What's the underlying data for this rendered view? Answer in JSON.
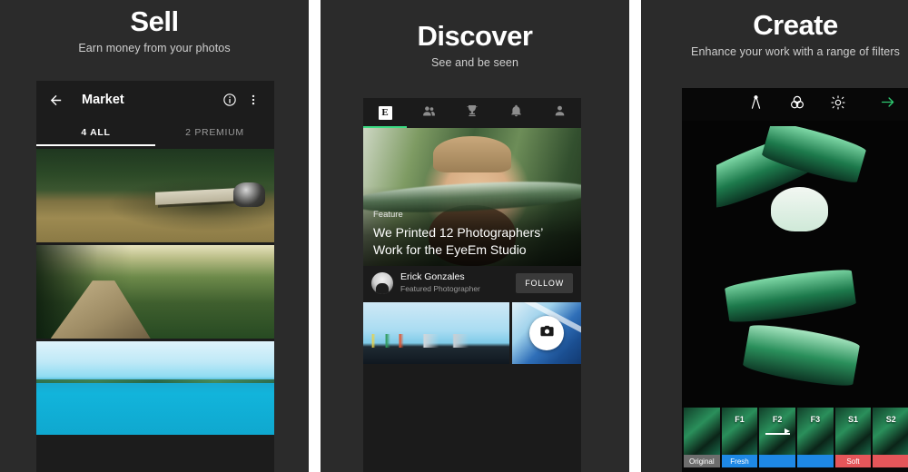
{
  "panels": [
    {
      "heading": "Sell",
      "subheading": "Earn money from your photos",
      "screen": {
        "appbar": {
          "title": "Market",
          "back_icon": "back-arrow-icon",
          "info_icon": "info-icon",
          "overflow_icon": "more-vert-icon"
        },
        "tabs": [
          {
            "label": "4 ALL",
            "active": true
          },
          {
            "label": "2 PREMIUM",
            "active": false
          }
        ],
        "photos": [
          {
            "name": "forest-bench-photo"
          },
          {
            "name": "forest-path-photo"
          },
          {
            "name": "turquoise-sea-photo"
          }
        ]
      }
    },
    {
      "heading": "Discover",
      "subheading": "See and be seen",
      "screen": {
        "tabs": [
          {
            "icon": "eyeem-logo-icon",
            "label": "E",
            "active": true
          },
          {
            "icon": "people-icon",
            "label": "",
            "active": false
          },
          {
            "icon": "trophy-icon",
            "label": "",
            "active": false
          },
          {
            "icon": "bell-icon",
            "label": "",
            "active": false
          },
          {
            "icon": "person-icon",
            "label": "",
            "active": false
          }
        ],
        "hero": {
          "kicker": "Feature",
          "title": "We Printed 12 Photographers’ Work for the EyeEm Studio"
        },
        "author": {
          "name": "Erick Gonzales",
          "role": "Featured Photographer",
          "follow_label": "FOLLOW",
          "avatar": "avatar"
        },
        "grid": [
          {
            "name": "beach-thumbnail"
          },
          {
            "name": "camera-thumbnail",
            "fab_icon": "camera-icon"
          }
        ]
      }
    },
    {
      "heading": "Create",
      "subheading": "Enhance your work with a range of filters",
      "screen": {
        "toolbar": [
          {
            "icon": "crop-transform-icon"
          },
          {
            "icon": "filters-circles-icon"
          },
          {
            "icon": "brightness-sun-icon"
          }
        ],
        "next_icon": "arrow-right-icon",
        "photo": {
          "name": "agave-plant-photo"
        },
        "filters": [
          {
            "code": "",
            "name": "Original",
            "selected": false,
            "color": "#6d6d6d"
          },
          {
            "code": "F1",
            "name": "Fresh",
            "selected": false,
            "color": "#1e88e5"
          },
          {
            "code": "F2",
            "name": "",
            "selected": true,
            "color": "#1e88e5"
          },
          {
            "code": "F3",
            "name": "",
            "selected": false,
            "color": "#1e88e5"
          },
          {
            "code": "S1",
            "name": "Soft",
            "selected": false,
            "color": "#e5565a"
          },
          {
            "code": "S2",
            "name": "",
            "selected": false,
            "color": "#e5565a"
          }
        ]
      }
    }
  ],
  "colors": {
    "background": "#2b2b2b",
    "accent_green": "#3ddc84",
    "gap": "#ffffff"
  }
}
